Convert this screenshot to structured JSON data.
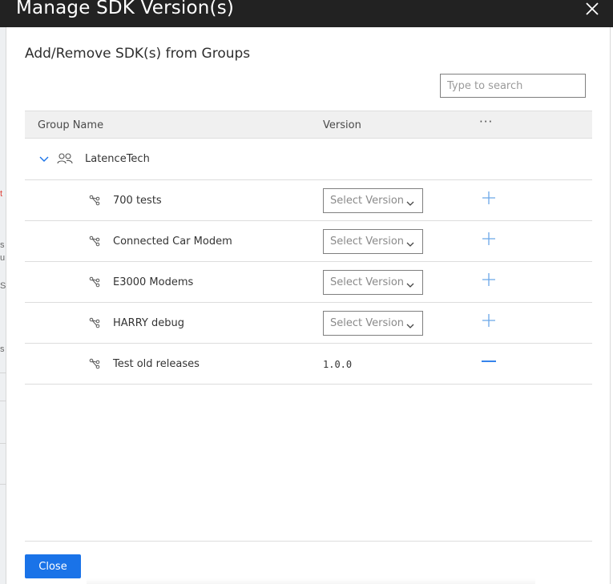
{
  "window": {
    "title": "Manage SDK Version(s)",
    "close_icon": "close-icon"
  },
  "backdrop": {
    "fragments": [
      "t",
      "s",
      "u",
      "S",
      "s"
    ]
  },
  "dialog": {
    "heading": "Add/Remove SDK(s) from Groups",
    "search": {
      "placeholder": "Type to search",
      "value": ""
    },
    "table": {
      "headers": {
        "name": "Group Name",
        "version": "Version",
        "more": "···"
      },
      "group": {
        "name": "LatenceTech",
        "expanded": true
      },
      "rows": [
        {
          "name": "700 tests",
          "select_placeholder": "Select Version",
          "action": "add"
        },
        {
          "name": "Connected Car Modem",
          "select_placeholder": "Select Version",
          "action": "add"
        },
        {
          "name": "E3000 Modems",
          "select_placeholder": "Select Version",
          "action": "add"
        },
        {
          "name": "HARRY debug",
          "select_placeholder": "Select Version",
          "action": "add"
        },
        {
          "name": "Test old releases",
          "version": "1.0.0",
          "action": "remove"
        }
      ]
    },
    "close_button": "Close"
  },
  "colors": {
    "accent": "#1a73e8",
    "titlebar": "#222222",
    "icon_blue": "#6aa6e8"
  }
}
